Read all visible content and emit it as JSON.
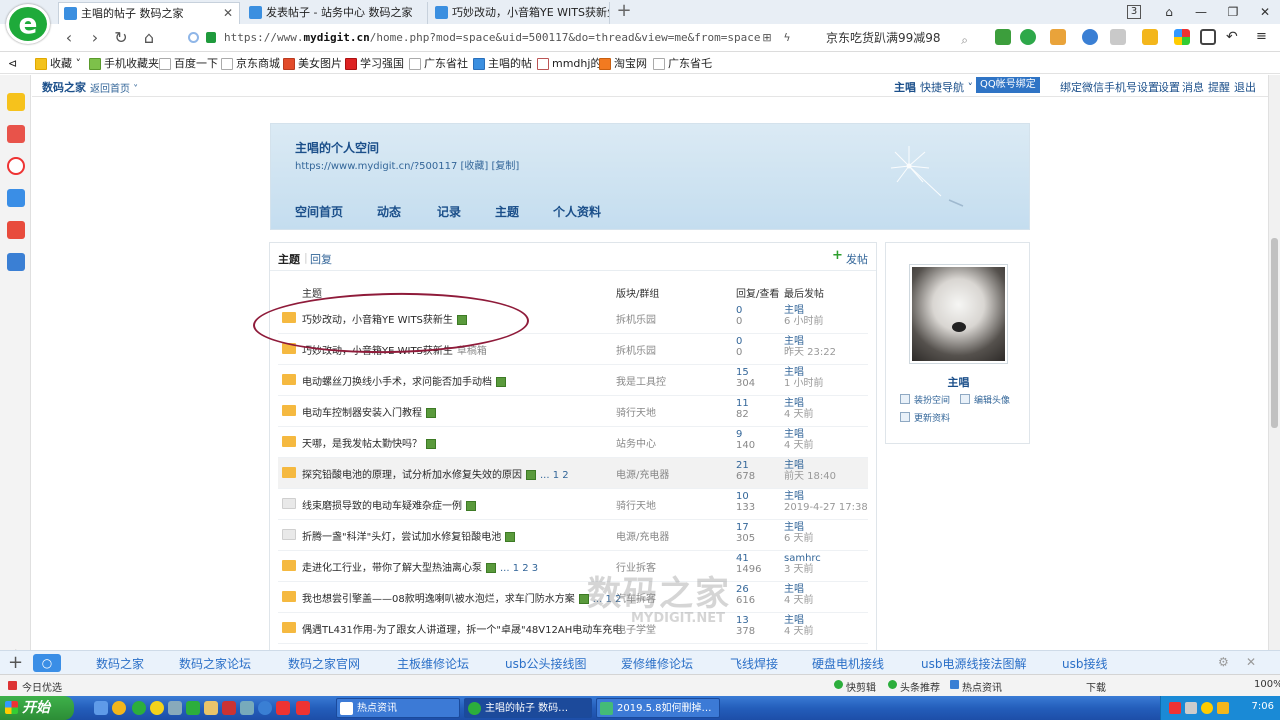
{
  "browser": {
    "tabs": [
      {
        "label": "主唱的帖子 数码之家",
        "active": true
      },
      {
        "label": "发表帖子 - 站务中心 数码之家",
        "active": false
      },
      {
        "label": "巧妙改动，小音箱YE WITS获新生",
        "active": false
      }
    ],
    "tab_count": "3",
    "url_prefix": "https://www.",
    "url_domain": "mydigit.cn",
    "url_rest": "/home.php?mod=space&uid=500117&do=thread&view=me&from=space",
    "search_text": "京东吃货趴满99减98"
  },
  "bookmarks": [
    "收藏",
    "手机收藏夹",
    "百度一下",
    "京东商城",
    "美女图片",
    "学习强国",
    "广东省社",
    "主唱的帖",
    "mmdhj的",
    "淘宝网",
    "广东省乇"
  ],
  "site": {
    "name": "数码之家",
    "back_home": "返回首页",
    "user": "主唱",
    "quick_nav": "快捷导航",
    "qq_bind": "QQ帐号绑定",
    "links": [
      "绑定微信",
      "手机号设置",
      "设置",
      "消息",
      "提醒",
      "退出"
    ]
  },
  "space": {
    "title": "主唱的个人空间",
    "url": "https://www.mydigit.cn/?500117",
    "collect": "[收藏]",
    "copy": "[复制]",
    "nav": [
      "空间首页",
      "动态",
      "记录",
      "主题",
      "个人资料"
    ]
  },
  "panel": {
    "tab_topics": "主题",
    "tab_replies": "回复",
    "post_button": "发帖",
    "headers": {
      "topic": "主题",
      "forum": "版块/群组",
      "counts": "回复/查看",
      "last": "最后发帖"
    }
  },
  "threads": [
    {
      "title": "巧妙改动，小音箱YE WITS获新生",
      "img": true,
      "draft": "",
      "pages": "",
      "forum": "拆机乐园",
      "replies": "0",
      "views": "0",
      "last_user": "主唱",
      "last_time": "6 小时前",
      "folder": "orange"
    },
    {
      "title": "巧妙改动，小音箱YE WITS获新生",
      "img": false,
      "draft": "草稿箱",
      "pages": "",
      "forum": "拆机乐园",
      "replies": "0",
      "views": "0",
      "last_user": "主唱",
      "last_time": "昨天 23:22",
      "folder": "orange"
    },
    {
      "title": "电动螺丝刀换线小手术，求问能否加手动档",
      "img": true,
      "draft": "",
      "pages": "",
      "forum": "我是工具控",
      "replies": "15",
      "views": "304",
      "last_user": "主唱",
      "last_time": "1 小时前",
      "folder": "orange"
    },
    {
      "title": "电动车控制器安装入门教程",
      "img": true,
      "draft": "",
      "pages": "",
      "forum": "骑行天地",
      "replies": "11",
      "views": "82",
      "last_user": "主唱",
      "last_time": "4 天前",
      "folder": "orange"
    },
    {
      "title": "天哪，是我发帖太勤快吗？",
      "img": true,
      "draft": "",
      "pages": "",
      "forum": "站务中心",
      "replies": "9",
      "views": "140",
      "last_user": "主唱",
      "last_time": "4 天前",
      "folder": "orange"
    },
    {
      "title": "探究铅酸电池的原理，试分析加水修复失效的原因",
      "img": true,
      "draft": "",
      "pages": "... 1 2",
      "forum": "电源/充电器",
      "replies": "21",
      "views": "678",
      "last_user": "主唱",
      "last_time": "前天 18:40",
      "folder": "orange",
      "highlight": true
    },
    {
      "title": "线束磨损导致的电动车疑难杂症一例",
      "img": true,
      "draft": "",
      "pages": "",
      "forum": "骑行天地",
      "replies": "10",
      "views": "133",
      "last_user": "主唱",
      "last_time": "2019-4-27 17:38",
      "folder": "gray"
    },
    {
      "title": "折腾一盏\"科洋\"头灯，尝试加水修复铅酸电池",
      "img": true,
      "draft": "",
      "pages": "",
      "forum": "电源/充电器",
      "replies": "17",
      "views": "305",
      "last_user": "主唱",
      "last_time": "6 天前",
      "folder": "gray"
    },
    {
      "title": "走进化工行业，带你了解大型热油离心泵",
      "img": true,
      "draft": "",
      "pages": "... 1 2 3",
      "forum": "行业拆客",
      "replies": "41",
      "views": "1496",
      "last_user": "samhrc",
      "last_time": "3 天前",
      "folder": "orange"
    },
    {
      "title": "我也想尝引擎盖——08款明逸喇叭被水泡烂，求车门防水方案",
      "img": true,
      "draft": "",
      "pages": "... 1 2",
      "forum": "汽车拆客",
      "replies": "26",
      "views": "616",
      "last_user": "主唱",
      "last_time": "4 天前",
      "folder": "orange"
    },
    {
      "title": "偶遇TL431作用-为了跟女人讲道理，拆一个\"卓晟\"48V12AH电动车充电器结",
      "img": true,
      "draft": "",
      "pages": "",
      "forum": "电子学堂",
      "replies": "13",
      "views": "378",
      "last_user": "主唱",
      "last_time": "4 天前",
      "folder": "orange"
    }
  ],
  "profile": {
    "name": "主唱",
    "links": [
      "装扮空间",
      "编辑头像",
      "更新资料"
    ]
  },
  "watermark": {
    "cn": "数码之家",
    "en": "MYDIGIT.NET"
  },
  "linkbar": [
    "数码之家",
    "数码之家论坛",
    "数码之家官网",
    "主板维修论坛",
    "usb公头接线图",
    "爱修维修论坛",
    "飞线焊接",
    "硬盘电机接线",
    "usb电源线接法图解",
    "usb接线"
  ],
  "statusbar": {
    "left": "今日优选",
    "items": [
      "快剪辑",
      "头条推荐",
      "热点资讯",
      "下载"
    ],
    "zoom": "100%"
  },
  "taskbar": {
    "start": "开始",
    "tasks": [
      "热点资讯",
      "主唱的帖子 数码…",
      "2019.5.8如何删掉…"
    ],
    "clock": "7:06"
  }
}
